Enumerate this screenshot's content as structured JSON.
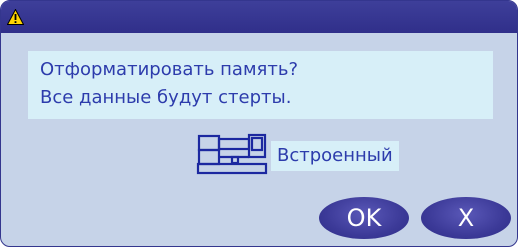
{
  "dialog": {
    "message_line1": "Отформатировать память?",
    "message_line2": "Все данные будут стерты.",
    "media_label": "Встроенный",
    "ok_label": "OK",
    "cancel_label": "X",
    "title_icon": "warning-icon",
    "media_icon": "sewing-machine-icon"
  },
  "colors": {
    "title_bar": "#302f8a",
    "body": "#c6d3e8",
    "message_bg": "#d7eff8",
    "text": "#2d3cac",
    "button": "#3c3a98"
  }
}
